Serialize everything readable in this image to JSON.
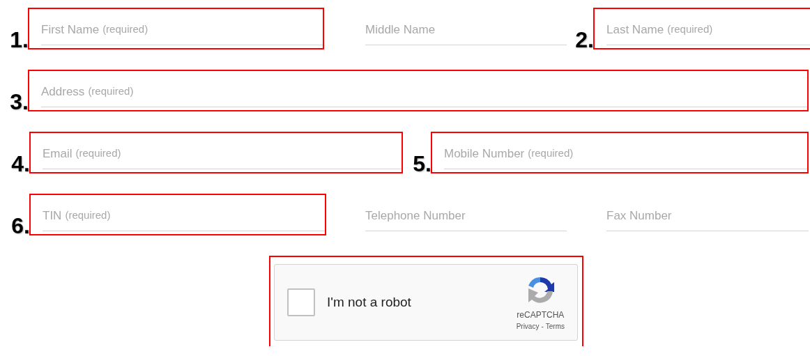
{
  "rows": [
    {
      "fields": [
        {
          "placeholder": "First Name",
          "note": "(required)",
          "number": "1.",
          "highlighted": true
        },
        {
          "placeholder": "Middle Name",
          "highlighted": false
        },
        {
          "placeholder": "Last Name",
          "note": "(required)",
          "number": "2.",
          "highlighted": true
        }
      ]
    },
    {
      "fields": [
        {
          "placeholder": "Address",
          "note": "(required)",
          "number": "3.",
          "highlighted": true
        }
      ]
    },
    {
      "fields": [
        {
          "placeholder": "Email",
          "note": "(required)",
          "number": "4.",
          "highlighted": true
        },
        {
          "placeholder": "Mobile Number",
          "note": "(required)",
          "number": "5.",
          "highlighted": true
        }
      ]
    },
    {
      "fields": [
        {
          "placeholder": "TIN",
          "note": "(required)",
          "number": "6.",
          "highlighted": true
        },
        {
          "placeholder": "Telephone Number",
          "highlighted": false
        },
        {
          "placeholder": "Fax Number",
          "highlighted": false
        }
      ]
    }
  ],
  "captcha": {
    "highlighted": true,
    "checked": false,
    "label": "I'm not a robot",
    "brand": "reCAPTCHA",
    "privacy_link": "Privacy",
    "separator": "-",
    "terms_link": "Terms"
  }
}
